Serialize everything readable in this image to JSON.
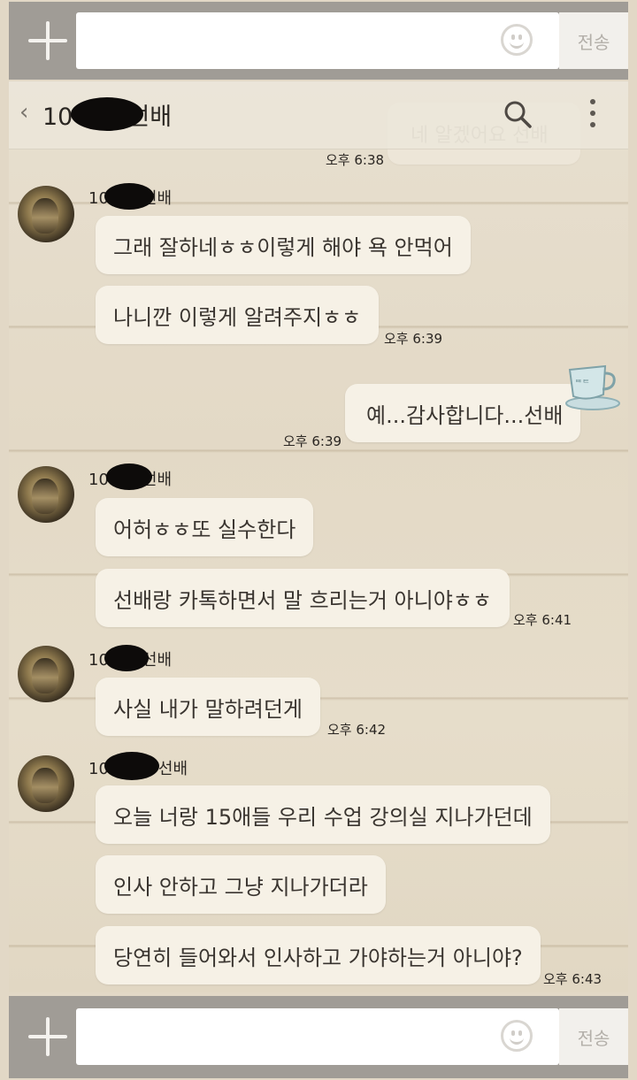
{
  "top_bar": {
    "send_label": "전송"
  },
  "bottom_bar": {
    "send_label": "전송"
  },
  "header": {
    "back_label": "‹",
    "title_prefix": "10",
    "title_suffix": "선배"
  },
  "faded_message": {
    "text": "네 알겠어요 선배",
    "time": "오후 6:38"
  },
  "messages": [
    {
      "sender_prefix": "10",
      "sender_suffix": "선배",
      "bubbles": [
        "그래 잘하네ㅎㅎ이렇게 해야 욕 안먹어",
        "나니깐 이렇게 알려주지ㅎㅎ"
      ],
      "time": "오후 6:39"
    },
    {
      "mine": true,
      "text": "예...감사합니다...선배",
      "time": "오후 6:39"
    },
    {
      "sender_prefix": "10",
      "sender_suffix": "선배",
      "bubbles": [
        "어허ㅎㅎ또 실수한다",
        "선배랑 카톡하면서 말 흐리는거 아니야ㅎㅎ"
      ],
      "time": "오후 6:41"
    },
    {
      "sender_prefix": "10",
      "sender_suffix": "선배",
      "bubbles": [
        "사실 내가 말하려던게"
      ],
      "time": "오후 6:42"
    },
    {
      "sender_prefix": "10",
      "sender_suffix": "선배",
      "bubbles": [
        "오늘 너랑 15애들 우리 수업 강의실 지나가던데",
        "인사 안하고 그냥 지나가더라",
        "당연히 들어와서 인사하고 가야하는거 아니야?"
      ],
      "time": "오후 6:43"
    }
  ]
}
